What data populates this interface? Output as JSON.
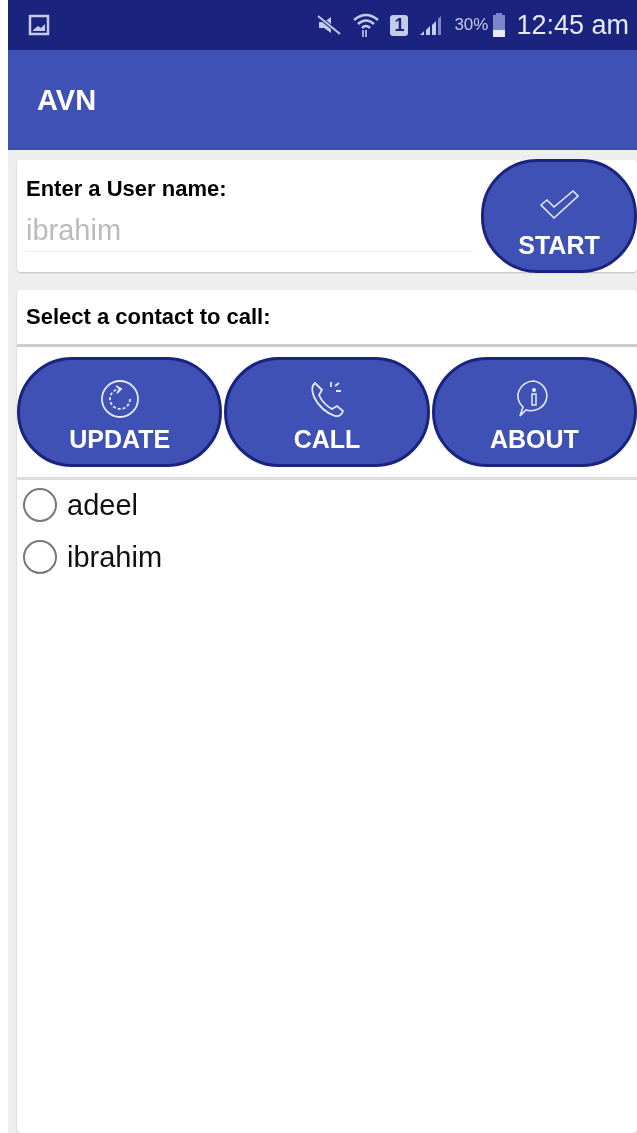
{
  "status_bar": {
    "sim": "1",
    "battery": "30%",
    "time": "12:45 am"
  },
  "app_bar": {
    "title": "AVN"
  },
  "user_card": {
    "label": "Enter a User name:",
    "placeholder": "ibrahim",
    "button": {
      "label": "START",
      "kind": "check"
    }
  },
  "contacts_card": {
    "title": "Select a contact to call:",
    "actions": [
      {
        "label": "UPDATE",
        "kind": "update"
      },
      {
        "label": "CALL",
        "kind": "call"
      },
      {
        "label": "ABOUT",
        "kind": "about"
      }
    ],
    "contacts": [
      {
        "name": "adeel",
        "selected": false
      },
      {
        "name": "ibrahim",
        "selected": false
      }
    ]
  }
}
